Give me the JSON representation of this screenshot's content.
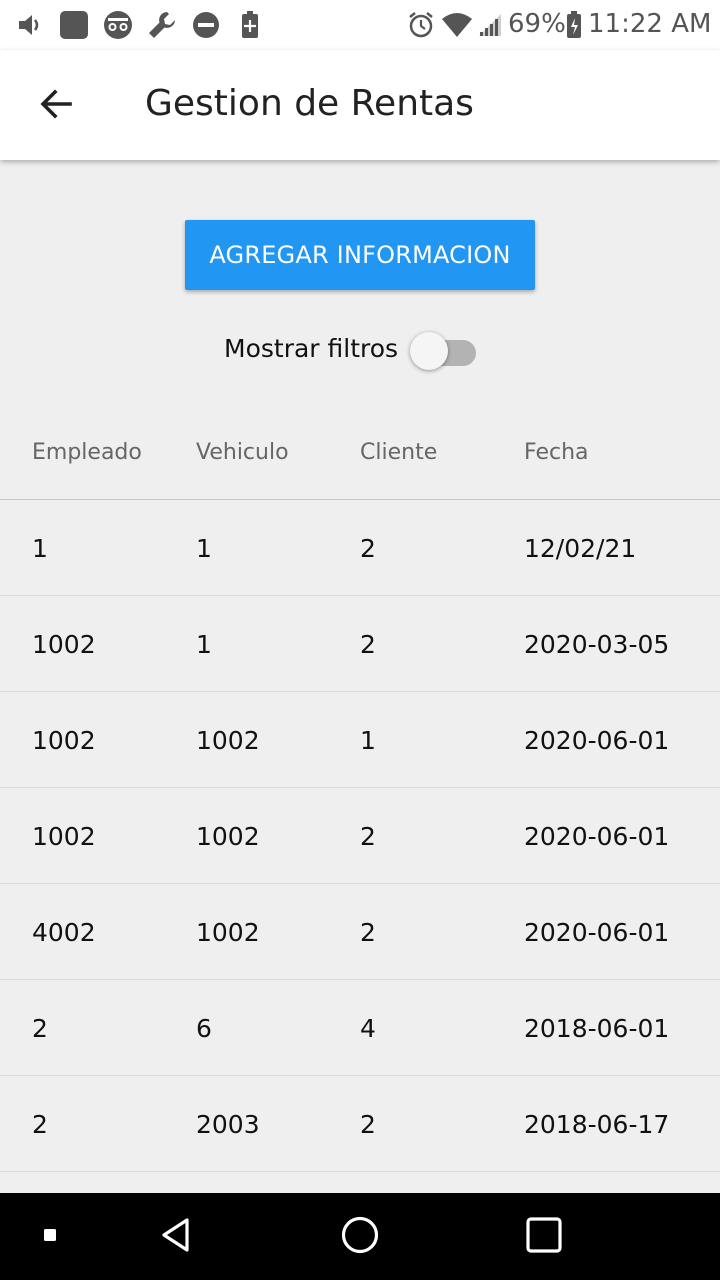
{
  "status_bar": {
    "battery_percent": "69%",
    "time": "11:22 AM",
    "icons": [
      "volume-icon",
      "app-square-icon",
      "incognito-icon",
      "wrench-icon",
      "do-not-disturb-icon",
      "battery-saver-icon",
      "alarm-icon",
      "wifi-icon",
      "signal-icon",
      "battery-charging-icon"
    ]
  },
  "app_bar": {
    "title": "Gestion de Rentas",
    "back_icon": "arrow-back-icon"
  },
  "main": {
    "add_button_label": "AGREGAR INFORMACION",
    "add_button_color": "#2196f3",
    "filter_label": "Mostrar filtros",
    "filter_enabled": false
  },
  "table": {
    "headers": [
      "Empleado",
      "Vehiculo",
      "Cliente",
      "Fecha"
    ],
    "rows": [
      [
        "1",
        "1",
        "2",
        "12/02/21"
      ],
      [
        "1002",
        "1",
        "2",
        "2020-03-05"
      ],
      [
        "1002",
        "1002",
        "1",
        "2020-06-01"
      ],
      [
        "1002",
        "1002",
        "2",
        "2020-06-01"
      ],
      [
        "4002",
        "1002",
        "2",
        "2020-06-01"
      ],
      [
        "2",
        "6",
        "4",
        "2018-06-01"
      ],
      [
        "2",
        "2003",
        "2",
        "2018-06-17"
      ]
    ]
  },
  "nav_bar": {
    "icons": [
      "recent-dot-icon",
      "back-triangle-icon",
      "home-circle-icon",
      "overview-square-icon"
    ]
  }
}
